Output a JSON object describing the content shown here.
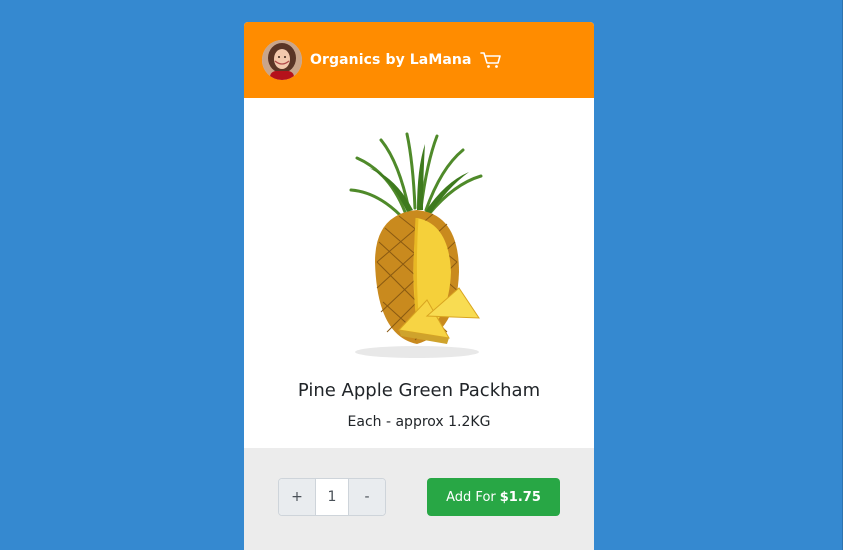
{
  "header": {
    "brand_name": "Organics by LaMana",
    "avatar_icon": "avatar-icon",
    "cart_icon": "cart-icon",
    "background_color": "#ff8c00"
  },
  "product": {
    "image_icon": "pineapple-image",
    "name": "Pine Apple Green Packham",
    "description": "Each - approx 1.2KG"
  },
  "quantity": {
    "plus_label": "+",
    "value": "1",
    "minus_label": "-"
  },
  "add_button": {
    "label": "Add For",
    "price": "$1.75",
    "color": "#28a745"
  },
  "page": {
    "background_color": "#3589d0"
  }
}
